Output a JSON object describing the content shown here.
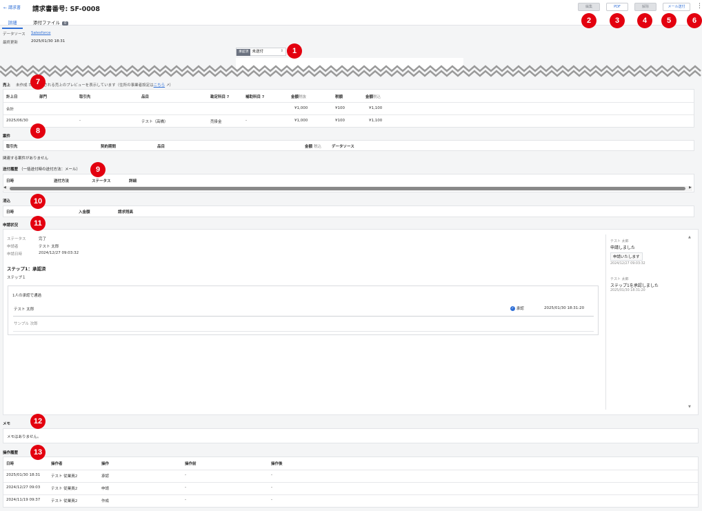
{
  "header": {
    "back_label": "請求書",
    "title": "請求書番号: SF-0008",
    "buttons": {
      "edit": "編集",
      "pdf": "PDF",
      "unlock": "解除",
      "send_mail": "メール送付"
    },
    "more": "⋮"
  },
  "tabs": [
    {
      "label": "詳細",
      "active": true
    },
    {
      "label": "添付ファイル",
      "count": "0"
    }
  ],
  "meta": {
    "source_label": "データソース",
    "source_value": "Salesforce",
    "updated_label": "最終更新",
    "updated_value": "2025/01/30 18:31"
  },
  "approval": {
    "tag": "承認済",
    "select_value": "未送付"
  },
  "badges": [
    "1",
    "2",
    "3",
    "4",
    "5",
    "6",
    "7",
    "8",
    "9",
    "10",
    "11",
    "12",
    "13"
  ],
  "sales": {
    "title": "売上",
    "note_a": "未作成",
    "note_b": "から作成される売上のプレビューを表示しています（住所の事業者設定は",
    "note_link": "こちら",
    "note_c": "）",
    "headers": [
      "計上日",
      "部門",
      "取引先",
      "品目",
      "勘定科目",
      "補助科目",
      "金額",
      "税抜",
      "税額",
      "金額",
      "税込"
    ],
    "total_label": "合計",
    "total": [
      "¥1,000",
      "¥100",
      "¥1,100"
    ],
    "row": [
      "2025/06/30",
      "-",
      "テスト（高橋）",
      "売掛金",
      "-",
      "¥1,000",
      "¥100",
      "¥1,100"
    ]
  },
  "deals": {
    "title": "案件",
    "headers": [
      "取引先",
      "契約期間",
      "品目",
      "金額",
      "税込",
      "データソース"
    ],
    "empty": "関連する案件がありません"
  },
  "send": {
    "title": "送付履歴",
    "subtitle": "（一括送付時の送付方法：メール）",
    "headers": [
      "日時",
      "送付方法",
      "ステータス",
      "詳細"
    ]
  },
  "clearing": {
    "title": "消込",
    "headers": [
      "日時",
      "入金額",
      "請求残高"
    ]
  },
  "application": {
    "title": "申請状況",
    "status_label": "ステータス",
    "status_value": "完了",
    "applicant_label": "申請者",
    "applicant_value": "テスト 太郎",
    "date_label": "申請日時",
    "date_value": "2024/12/27 09:03:32",
    "step_title": "ステップ1：承認済",
    "step_sub": "ステップ１",
    "approvers_note": "1人の承認で通過",
    "approver1": "テスト 太郎",
    "approver1_status": "承認",
    "approver1_time": "2025/01/30 18:31:20",
    "approver2": "サンプル 次郎",
    "comments": [
      {
        "user": "テスト 太郎",
        "text": "申請しました",
        "bubble": "申請いたします",
        "time": "2024/12/27 09:03:32"
      },
      {
        "user": "テスト 太郎",
        "text": "ステップ1を承認しました",
        "time": "2025/01/30 18:31:20"
      }
    ]
  },
  "memo": {
    "title": "メモ",
    "empty": "メモはありません。"
  },
  "history": {
    "title": "操作履歴",
    "headers": [
      "日時",
      "操作者",
      "操作",
      "操作前",
      "操作後"
    ],
    "rows": [
      [
        "2025/01/30 18:31",
        "テスト 従業員2",
        "承認",
        "-",
        "-"
      ],
      [
        "2024/12/27 09:03",
        "テスト 従業員2",
        "申請",
        "-",
        "-"
      ],
      [
        "2024/11/19 09:37",
        "テスト 従業員2",
        "作成",
        "-",
        "-"
      ]
    ]
  }
}
